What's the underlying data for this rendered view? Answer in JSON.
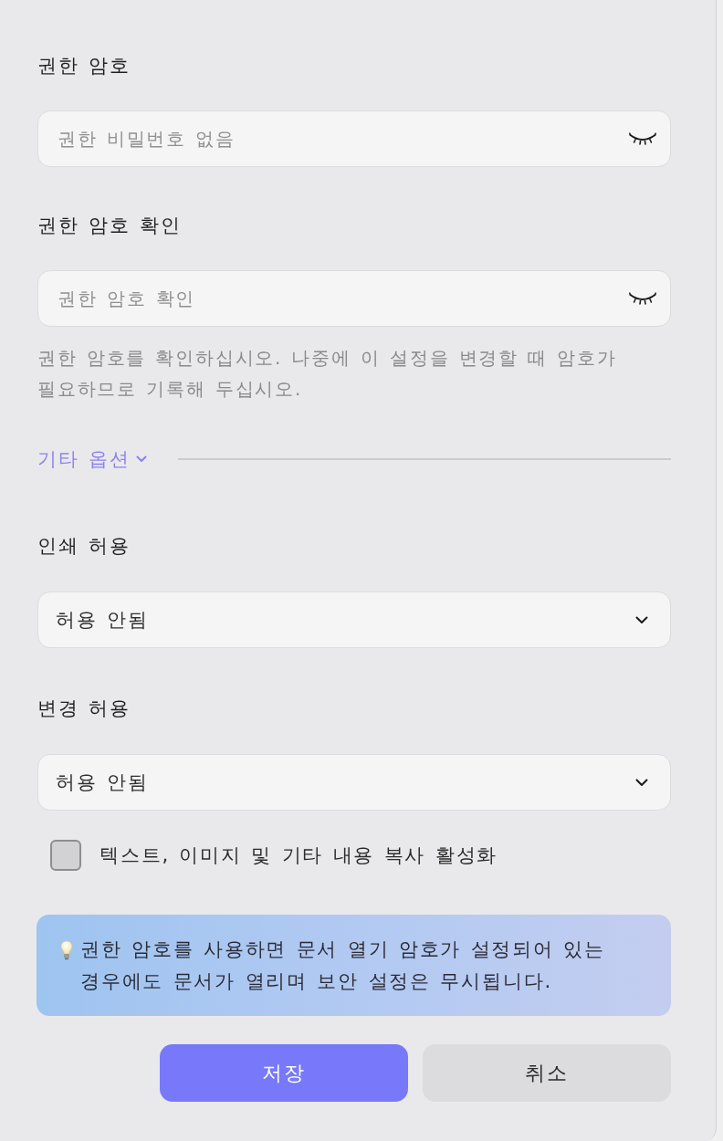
{
  "password_fields": [
    {
      "label": "권한 암호",
      "placeholder": "권한 비밀번호 없음"
    },
    {
      "label": "권한 암호 확인",
      "placeholder": "권한 암호 확인",
      "hint": "권한 암호를 확인하십시오. 나중에 이 설정을 변경할 때 암호가 필요하므로 기록해 두십시오."
    }
  ],
  "more_options": {
    "label": "기타 옵션"
  },
  "permission_fields": [
    {
      "label": "인쇄 허용",
      "value": "허용 안됨"
    },
    {
      "label": "변경 허용",
      "value": "허용 안됨"
    }
  ],
  "copy_option": {
    "label": "텍스트, 이미지 및 기타 내용 복사 활성화",
    "checked": false
  },
  "notice": {
    "text": "권한 암호를 사용하면 문서 열기 암호가 설정되어 있는 경우에도 문서가 열리며 보안 설정은 무시됩니다."
  },
  "buttons": [
    {
      "label": "저장",
      "kind": "primary"
    },
    {
      "label": "취소",
      "kind": "secondary"
    }
  ]
}
